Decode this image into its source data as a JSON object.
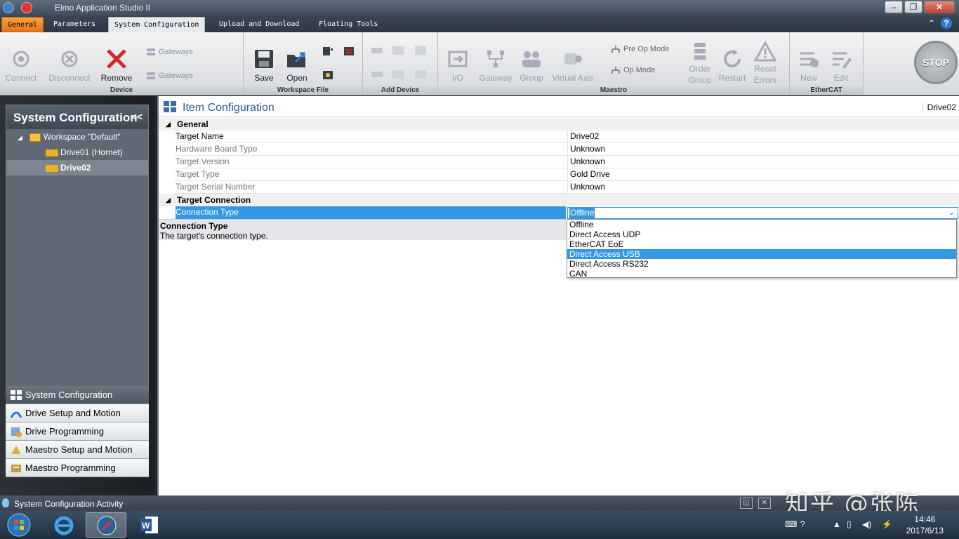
{
  "window": {
    "title": "Elmo Application Studio II"
  },
  "tabs": {
    "general": "General",
    "parameters": "Parameters",
    "system_configuration": "System Configuration",
    "upload_download": "Upload and Download",
    "floating_tools": "Floating Tools"
  },
  "ribbon": {
    "device": {
      "label": "Device",
      "connect": "Connect",
      "disconnect": "Disconnect",
      "remove": "Remove",
      "gateways_1": "Gateways",
      "gateways_2": "Gateways"
    },
    "workspace_file": {
      "label": "Workspace File",
      "save": "Save",
      "open": "Open"
    },
    "add_device": {
      "label": "Add Device"
    },
    "maestro": {
      "label": "Maestro",
      "io": "I/O",
      "gateway": "Gateway",
      "group": "Group",
      "virtual_axis": "Virtual Axis",
      "pre_op_mode": "Pre Op Mode",
      "op_mode": "Op Mode",
      "order_group": "Order Group",
      "restart": "Restart",
      "reset_errors": "Reset Errors"
    },
    "ethercat": {
      "label": "EtherCAT",
      "new": "New",
      "edit": "Edit"
    },
    "stop": "STOP"
  },
  "left_panel": {
    "title": "System Configuration",
    "tree": {
      "workspace": "Workspace \"Default\"",
      "drive01": "Drive01 (Hornet)",
      "drive02": "Drive02"
    },
    "nav": [
      "System Configuration",
      "Drive Setup and Motion",
      "Drive Programming",
      "Maestro Setup and Motion",
      "Maestro Programming"
    ]
  },
  "main": {
    "title": "Item Configuration",
    "selected_target": "Drive02",
    "general": {
      "label": "General",
      "rows": [
        {
          "name": "Target Name",
          "value": "Drive02"
        },
        {
          "name": "Hardware Board Type",
          "value": "Unknown"
        },
        {
          "name": "Target Version",
          "value": "Unknown"
        },
        {
          "name": "Target Type",
          "value": "Gold Drive"
        },
        {
          "name": "Target Serial Number",
          "value": "Unknown"
        }
      ]
    },
    "target_connection": {
      "label": "Target Connection",
      "connection_type_label": "Connection Type",
      "connection_type_value": "Offline",
      "options": [
        "Offline",
        "Direct Access UDP",
        "EtherCAT EoE",
        "Direct Access USB",
        "Direct Access RS232",
        "CAN"
      ],
      "highlighted_option": "Direct Access USB"
    },
    "description": {
      "title": "Connection Type",
      "text": "The target's connection type."
    }
  },
  "status_bar": {
    "text": "System Configuration Activity"
  },
  "watermark": "知乎 @张陈",
  "taskbar": {
    "time": "14:46",
    "date": "2017/6/13"
  },
  "colors": {
    "accent": "#3399e6",
    "general_tab": "#f29a32",
    "remove_red": "#d8232a"
  }
}
